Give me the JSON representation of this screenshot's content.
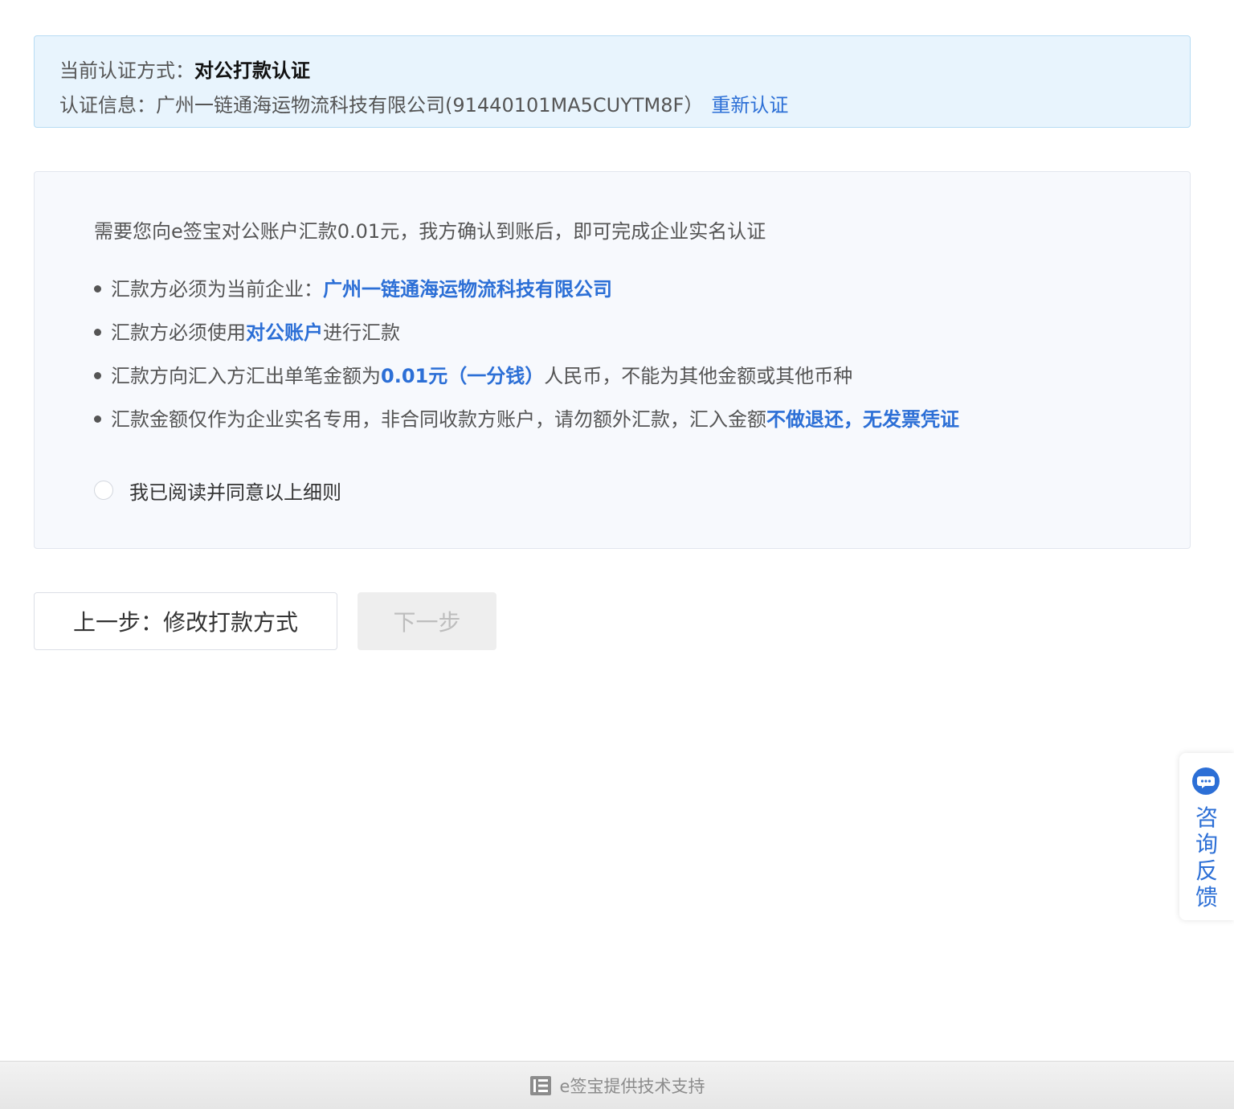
{
  "info_box": {
    "method_label": "当前认证方式：",
    "method_value": "对公打款认证",
    "info_label": "认证信息：",
    "info_value": "广州一链通海运物流科技有限公司(91440101MA5CUYTM8F）",
    "reauth_link": "重新认证"
  },
  "rules_card": {
    "intro": "需要您向e签宝对公账户汇款0.01元，我方确认到账后，即可完成企业实名认证",
    "rules": [
      {
        "before": "汇款方必须为当前企业：",
        "highlight": "广州一链通海运物流科技有限公司",
        "after": ""
      },
      {
        "before": "汇款方必须使用",
        "highlight": "对公账户",
        "after": "进行汇款"
      },
      {
        "before": "汇款方向汇入方汇出单笔金额为",
        "highlight": "0.01元（一分钱）",
        "after": "人民币，不能为其他金额或其他币种"
      },
      {
        "before": "汇款金额仅作为企业实名专用，非合同收款方账户，请勿额外汇款，汇入金额",
        "highlight": "不做退还，无发票凭证",
        "after": ""
      }
    ],
    "agree_label": "我已阅读并同意以上细则",
    "agree_checked": false
  },
  "buttons": {
    "prev_label": "上一步：修改打款方式",
    "next_label": "下一步"
  },
  "consult": {
    "icon": "chat-bubble-icon",
    "chars": [
      "咨",
      "询",
      "反",
      "馈"
    ]
  },
  "footer": {
    "logo_icon": "esign-logo-icon",
    "text": "e签宝提供技术支持"
  },
  "colors": {
    "accent": "#2c6fd6",
    "info_bg": "#e8f4fd",
    "card_bg": "#f7f9fd",
    "disabled_bg": "#eeeeee"
  }
}
